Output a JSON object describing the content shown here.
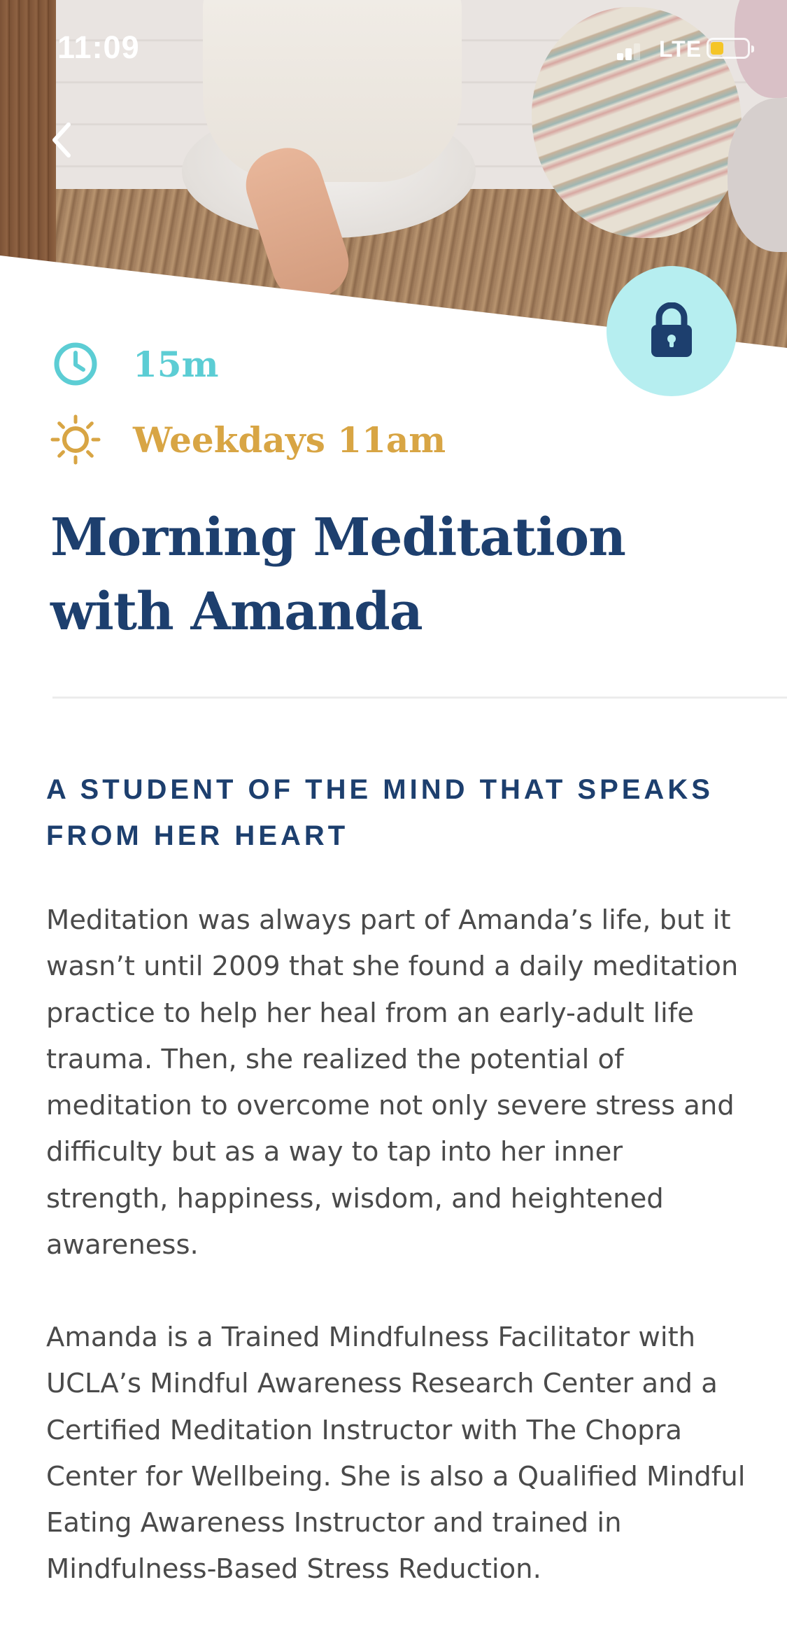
{
  "status_bar": {
    "time": "11:09",
    "network": "LTE",
    "battery_color": "#f5c527"
  },
  "hero": {
    "image_description_icon": "hero-photo",
    "back_icon": "chevron-left-icon",
    "lock_icon": "lock-icon",
    "lock_button_color": "#b6eef0"
  },
  "session": {
    "duration": "15m",
    "duration_icon": "clock-icon",
    "duration_color": "#5ccdd4",
    "schedule": "Weekdays 11am",
    "schedule_icon": "sun-icon",
    "schedule_color": "#d8a544",
    "title": "Morning Meditation with Amanda",
    "title_color": "#1d3f6e"
  },
  "about": {
    "heading": "A STUDENT OF THE MIND THAT SPEAKS FROM HER HEART",
    "paragraphs": [
      "Meditation was always part of Amanda’s life, but it wasn’t until 2009 that she found a daily meditation practice to help her heal from an early-adult life trauma. Then, she realized the potential of meditation to overcome not only severe stress and difficulty but as a way to tap into her inner strength, happiness, wisdom, and heightened awareness.",
      "Amanda is a Trained Mindfulness Facilitator with UCLA’s Mindful Awareness Research Center and a Certified Meditation Instructor with The Chopra Center for Wellbeing. She is also a Qualified Mindful Eating Awareness Instructor and trained in Mindfulness-Based Stress Reduction."
    ]
  }
}
